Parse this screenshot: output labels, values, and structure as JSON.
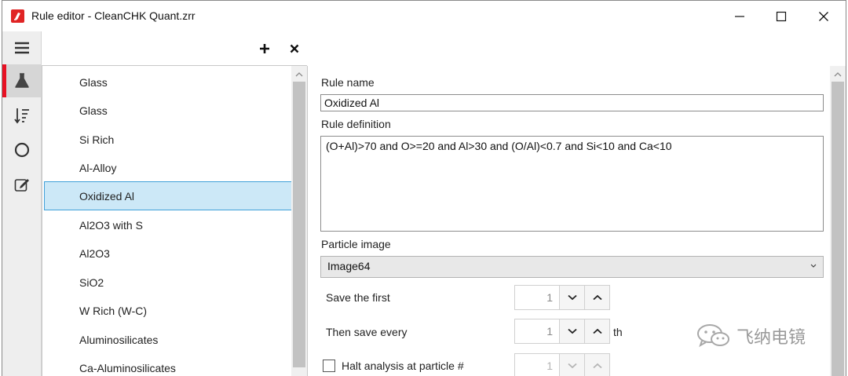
{
  "window": {
    "title": "Rule editor - CleanCHK Quant.zrr"
  },
  "icons": {
    "app": "app-logo-icon",
    "minimize": "minimize-icon",
    "maximize": "maximize-icon",
    "close": "close-icon",
    "menu": "hamburger-menu-icon",
    "rules": "flask-icon",
    "sort": "sort-descending-icon",
    "circle": "circle-icon",
    "edit": "edit-icon",
    "add": "plus-icon",
    "delete": "x-icon",
    "watermark": "wechat-icon"
  },
  "colors": {
    "accent": "#e81123",
    "selection_bg": "#cce8f7",
    "selection_border": "#40a0d8"
  },
  "rules": [
    "Glass",
    "Glass",
    "Si Rich",
    "Al-Alloy",
    "Oxidized Al",
    "Al2O3 with S",
    "Al2O3",
    "SiO2",
    "W Rich (W-C)",
    "Aluminosilicates",
    "Ca-Aluminosilicates"
  ],
  "selected_rule": "Oxidized Al",
  "detail": {
    "rule_name_label": "Rule name",
    "rule_name_value": "Oxidized Al",
    "rule_definition_label": "Rule definition",
    "rule_definition_value": "(O+Al)>70 and O>=20 and Al>30 and (O/Al)<0.7 and Si<10 and Ca<10",
    "particle_image_label": "Particle image",
    "particle_image_value": "Image64",
    "save_first_label": "Save the first",
    "save_first_value": "1",
    "save_every_label": "Then save every",
    "save_every_value": "1",
    "save_every_suffix": "th",
    "halt_label": "Halt analysis at particle #",
    "halt_value": "1",
    "halt_checked": false
  },
  "watermark_text": "飞纳电镜"
}
